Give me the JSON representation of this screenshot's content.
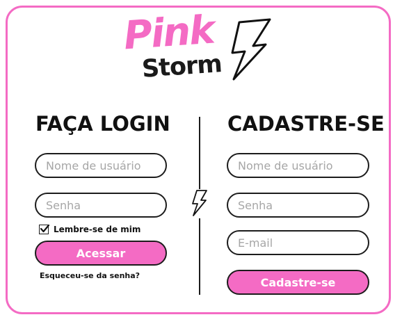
{
  "logo": {
    "line1": "Pink",
    "line2": "Storm"
  },
  "login": {
    "title": "FAÇA LOGIN",
    "username_placeholder": "Nome de usuário",
    "password_placeholder": "Senha",
    "remember_label": "Lembre-se de mim",
    "remember_checked": true,
    "submit_label": "Acessar",
    "forgot_label": "Esqueceu-se da senha?"
  },
  "signup": {
    "title": "CADASTRE-SE",
    "username_placeholder": "Nome de usuário",
    "password_placeholder": "Senha",
    "email_placeholder": "E-mail",
    "submit_label": "Cadastre-se"
  },
  "colors": {
    "accent": "#f46bc4",
    "ink": "#1c1c1c",
    "placeholder": "#a6a6a6"
  },
  "icons": {
    "logo_bolt": "lightning-bolt-icon",
    "divider_bolt": "lightning-bolt-icon",
    "checkbox_mark": "check-icon"
  }
}
